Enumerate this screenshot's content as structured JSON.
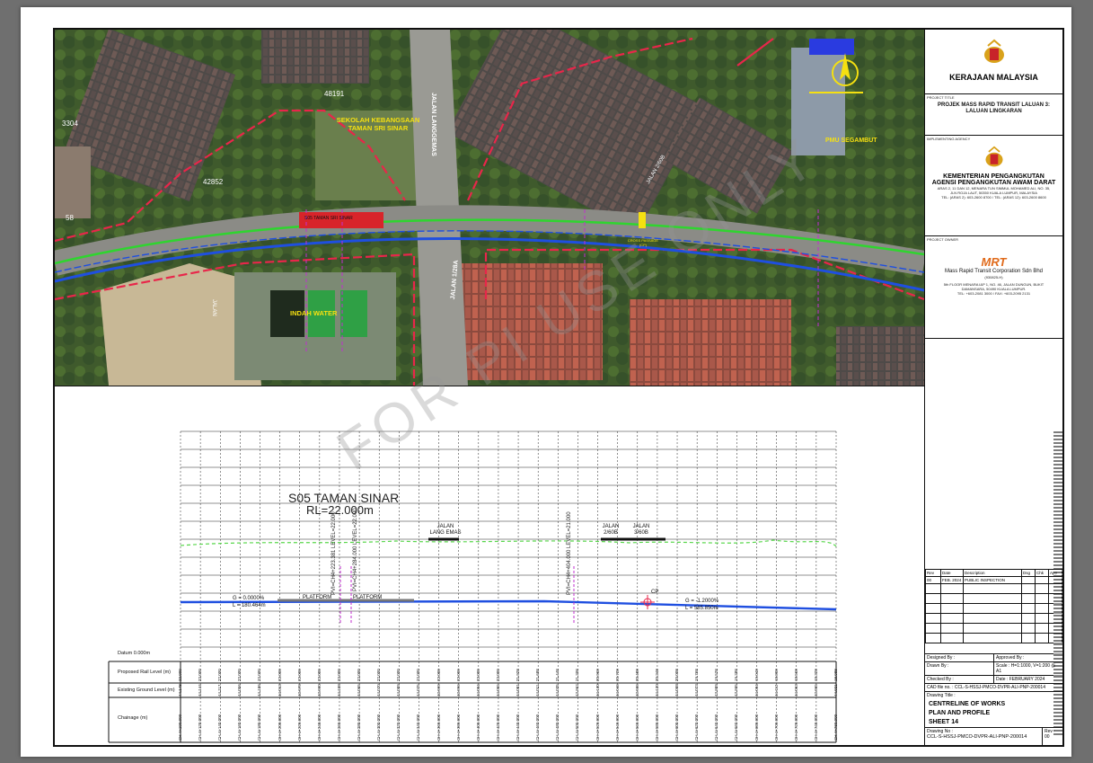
{
  "map": {
    "labels": {
      "school": "SEKOLAH KEBANGSAAN\nTAMAN SRI SINAR",
      "school_l1": "SEKOLAH KEBANGSAAN",
      "school_l2": "TAMAN SRI SINAR",
      "water": "INDAH WATER",
      "pmu": "PMU SEGAMBUT",
      "road_langgemas": "JALAN LANGGEMAS",
      "road_1_28a": "JALAN 1/28A",
      "road_2_60b": "JALAN 2/60B",
      "road_bottom_left": "JALAN",
      "station": "S05 TAMAN SRI SINAR",
      "cross_passage": "CROSS PASSAGE\n(CP)",
      "cp_l1": "CROSS PASSAGE",
      "cp_l2": "(CP)",
      "lot1": "48191",
      "lot2": "42852",
      "lot3": "58",
      "lot4": "3304"
    }
  },
  "title_block": {
    "client": "KERAJAAN MALAYSIA",
    "project_title_label": "PROJECT TITLE",
    "project_title": "PROJEK MASS RAPID TRANSIT LALUAN 3: LALUAN LINGKARAN",
    "agency_label": "IMPLEMENTING AGENCY",
    "agency_1": "KEMENTERIAN PENGANGKUTAN",
    "agency_2": "AGENSI PENGANGKUTAN AWAM DARAT",
    "agency_address": "ARAS 2, 11 DAN 12, MENARA TUN SIMMUL MOHAMED ALI, NO. 35, JLN ROJA LAUT, 50350 KUALA LUMPUR, MALAYSIA",
    "agency_tel": "TEL: (ARAS 2): 603-2600 8700 / TEL: (ARAS 12): 603-2600 8600",
    "owner_label": "PROJECT OWNER",
    "owner_logo": "MRT",
    "owner_name": "Mass Rapid Transit Corporation Sdn Bhd",
    "owner_reg": "(930825-H)",
    "owner_address": "5th FLOOR MENARA I&P 1, NO. 46, JALAN DUNGUN, BUKIT DAMANSARA, 50490 KUALA LUMPUR.",
    "owner_tel": "TEL: +603-2081 3000 / FAX: +603-2095 2131",
    "rev_headers": [
      "Rev",
      "Date",
      "Description",
      "Dsg",
      "Chk",
      "App"
    ],
    "rev_row": [
      "00",
      "FEB. 2024",
      "PUBLIC INSPECTION",
      "",
      "",
      ""
    ],
    "designed_by": "Designed By :",
    "approved_by": "Approved By :",
    "drawn_by": "Drawn By :",
    "scale": "Scale : H=1:1000, V=1:200 @ A1",
    "checked_by": "Checked By :",
    "date": "Date : FEBRUARY 2024",
    "cad_file": "CAD file no. :  CCL-S-HSSJ-PMCO-DVPR-ALI-PNP-200014",
    "drawing_title_label": "Drawing Title :",
    "drawing_title_1": "CENTRELINE OF WORKS",
    "drawing_title_2": "PLAN AND PROFILE",
    "drawing_title_3": "SHEET 14",
    "drawing_no_label": "Drawing No :",
    "drawing_no": "CCL-S-HSSJ-PMCO-DVPR-ALI-PNP-200014",
    "rev_label": "Rev :",
    "rev": "00"
  },
  "profile": {
    "station_title": "S05 TAMAN SINAR",
    "station_rl": "RL=22.000m",
    "platform_1": "PLATFORM",
    "platform_2": "PLATFORM",
    "road_1_l1": "JALAN",
    "road_1_l2": "LANG EMAS",
    "road_2_l1": "JALAN",
    "road_2_l2": "2/60B",
    "road_3_l1": "JALAN",
    "road_3_l2": "3/60B",
    "grade_1": "G = 0.0000%",
    "length_1": "L = 180.464m",
    "grade_2": "G = -1.2000%",
    "length_2": "L = 585.850m",
    "cp": "CP",
    "pvi_1": "PVI=CH4+223.381 LEVEL=22.000",
    "pvi_2": "PVI=CH4+284.000 LEVEL=22.000",
    "pvi_3": "PVI=CH4+404.000 LEVEL=21.000",
    "datum": "Datum 0.000m",
    "row_labels": [
      "Proposed Rail Level (m)",
      "Existing Ground Level (m)",
      "Chainage (m)"
    ],
    "chainages": [
      "CH 4+100.000",
      "CH 4+120.000",
      "CH 4+140.000",
      "CH 4+160.000",
      "CH 4+180.000",
      "CH 4+200.000",
      "CH 4+220.000",
      "CH 4+240.000",
      "CH 4+260.000",
      "CH 4+280.000",
      "CH 4+300.000",
      "CH 4+320.000",
      "CH 4+340.000",
      "CH 4+360.000",
      "CH 4+380.000",
      "CH 4+400.000",
      "CH 4+420.000",
      "CH 4+440.000",
      "CH 4+460.000",
      "CH 4+480.000",
      "CH 4+500.000",
      "CH 4+520.000",
      "CH 4+540.000",
      "CH 4+560.000",
      "CH 4+580.000",
      "CH 4+600.000",
      "CH 4+620.000",
      "CH 4+640.000",
      "CH 4+660.000",
      "CH 4+680.000",
      "CH 4+700.000",
      "CH 4+720.000",
      "CH 4+740.000",
      "CH 4+760.000"
    ],
    "rail_levels": [
      "22.000",
      "22.000",
      "22.000",
      "22.000",
      "22.000",
      "22.000",
      "22.000",
      "22.000",
      "22.000",
      "22.000",
      "22.000",
      "22.000",
      "22.000",
      "22.000",
      "22.000",
      "22.000",
      "22.000",
      "21.928",
      "21.688",
      "21.448",
      "21.208",
      "20.968",
      "20.728",
      "20.488",
      "20.248",
      "20.008",
      "19.768",
      "19.528",
      "19.288",
      "19.048",
      "18.808",
      "18.568",
      "18.328",
      "18.088"
    ],
    "ground_levels": [
      "44.148",
      "44.144",
      "44.117",
      "44.056",
      "44.186",
      "44.013",
      "43.978",
      "43.990",
      "44.108",
      "44.065",
      "44.070",
      "44.089",
      "44.075",
      "43.999",
      "43.896",
      "44.004",
      "44.055",
      "44.081",
      "44.011",
      "44.035",
      "43.962",
      "44.130",
      "44.046",
      "43.936",
      "44.120",
      "44.098",
      "44.073",
      "43.989",
      "43.995",
      "44.084",
      "44.112",
      "44.063",
      "43.965",
      "44.021"
    ]
  },
  "watermark": "FOR PI USE ONLY",
  "colors": {
    "alignment_blue": "#1f4fe0",
    "alignment_green": "#2fd52f",
    "boundary_red": "#e8264a",
    "ground_green": "#57d64a"
  }
}
